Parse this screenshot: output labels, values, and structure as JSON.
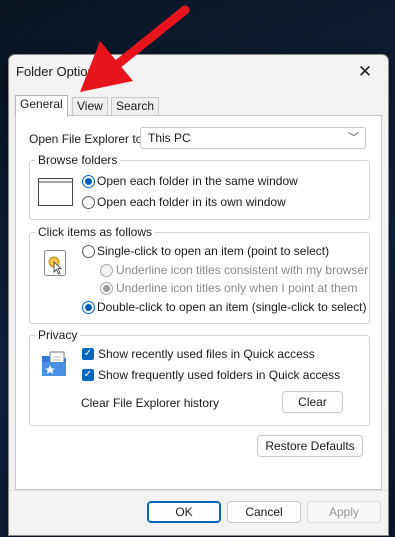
{
  "window": {
    "title": "Folder Options"
  },
  "tabs": [
    {
      "label": "General",
      "active": true
    },
    {
      "label": "View",
      "active": false
    },
    {
      "label": "Search",
      "active": false
    }
  ],
  "general": {
    "open_explorer_label": "Open File Explorer to:",
    "open_explorer_value": "This PC",
    "browse_folders": {
      "title": "Browse folders",
      "options": [
        {
          "label": "Open each folder in the same window",
          "selected": true
        },
        {
          "label": "Open each folder in its own window",
          "selected": false
        }
      ]
    },
    "click_items": {
      "title": "Click items as follows",
      "single_click": {
        "label": "Single-click to open an item (point to select)",
        "selected": false
      },
      "sub_options": [
        {
          "label": "Underline icon titles consistent with my browser",
          "selected": false,
          "enabled": false
        },
        {
          "label": "Underline icon titles only when I point at them",
          "selected": true,
          "enabled": false
        }
      ],
      "double_click": {
        "label": "Double-click to open an item (single-click to select)",
        "selected": true
      }
    },
    "privacy": {
      "title": "Privacy",
      "checks": [
        {
          "label": "Show recently used files in Quick access",
          "checked": true
        },
        {
          "label": "Show frequently used folders in Quick access",
          "checked": true
        }
      ],
      "clear_history_label": "Clear File Explorer history",
      "clear_button": "Clear"
    },
    "restore_defaults": "Restore Defaults"
  },
  "footer": {
    "ok": "OK",
    "cancel": "Cancel",
    "apply": "Apply"
  },
  "colors": {
    "accent": "#0067c0",
    "arrow": "#e8141c"
  }
}
